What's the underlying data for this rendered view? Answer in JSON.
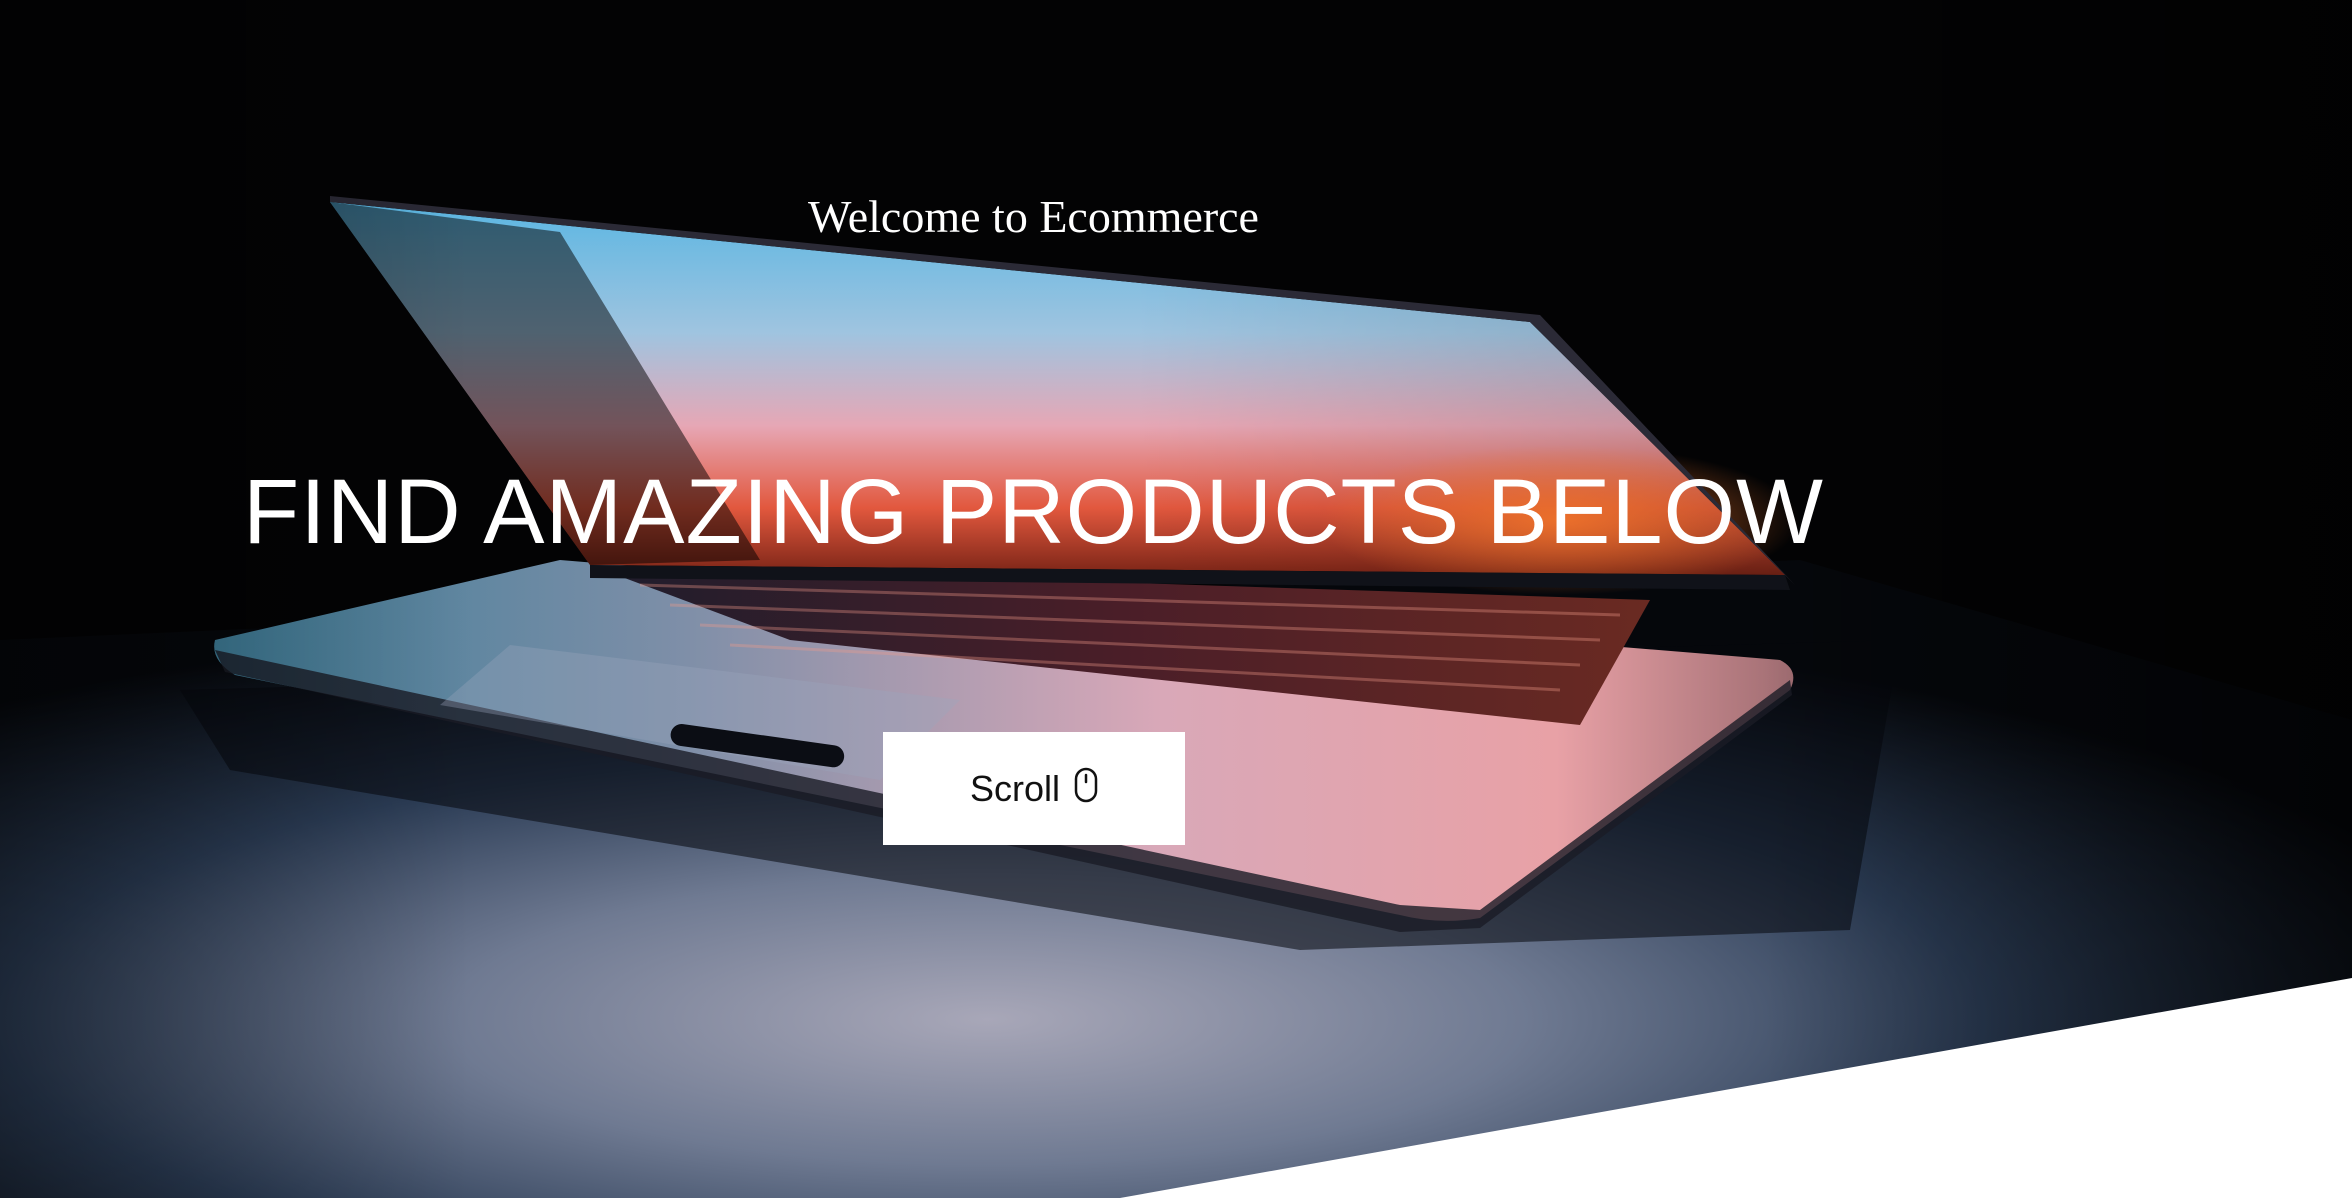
{
  "hero": {
    "welcome_text": "Welcome to Ecommerce",
    "headline": "FIND AMAZING PRODUCTS BELOW",
    "scroll_label": "Scroll",
    "scroll_icon": "mouse-icon",
    "background_image": "laptop-photo"
  },
  "colors": {
    "background": "#020203",
    "text": "#ffffff",
    "button_bg": "#ffffff",
    "button_text": "#111111"
  }
}
